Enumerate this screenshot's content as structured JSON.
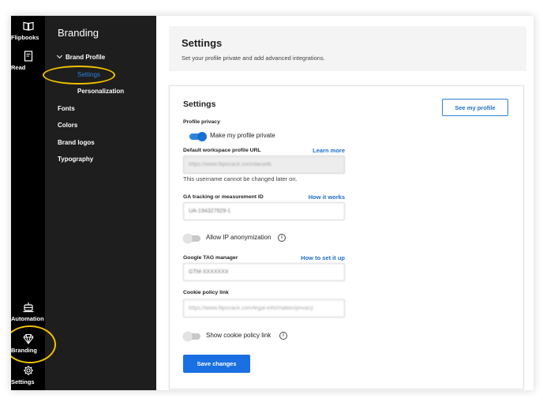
{
  "rail": {
    "items": [
      {
        "label": "Flipbooks",
        "icon": "book-icon"
      },
      {
        "label": "Read",
        "icon": "document-icon"
      },
      {
        "label": "Automation",
        "icon": "robot-icon"
      },
      {
        "label": "Branding",
        "icon": "diamond-icon"
      },
      {
        "label": "Settings",
        "icon": "gear-icon"
      }
    ]
  },
  "sidebar": {
    "title": "Branding",
    "group": "Brand Profile",
    "sub_items": [
      "Settings",
      "Personalization"
    ],
    "items": [
      "Fonts",
      "Colors",
      "Brand logos",
      "Typography"
    ]
  },
  "header": {
    "title": "Settings",
    "subtitle": "Set your profile private and add advanced integrations."
  },
  "card": {
    "title": "Settings",
    "see_profile_label": "See my profile",
    "privacy_label": "Profile privacy",
    "private_toggle_label": "Make my profile private",
    "private_toggle_on": true,
    "workspace_url_label": "Default workspace profile URL",
    "workspace_url_link": "Learn more",
    "workspace_url_value": "https://www.flipsnack.com/danielb",
    "workspace_url_help": "This username cannot be changed later on.",
    "ga_label": "GA tracking or measurement ID",
    "ga_link": "How it works",
    "ga_value": "UA-194327929-1",
    "ip_toggle_label": "Allow IP anonymization",
    "ip_toggle_on": false,
    "gtm_label": "Google TAG manager",
    "gtm_link": "How to set it up",
    "gtm_value": "GTM-XXXXXXX",
    "cookie_label": "Cookie policy link",
    "cookie_value": "https://www.flipsnack.com/legal-information/privacy",
    "cookie_toggle_label": "Show cookie policy link",
    "cookie_toggle_on": false,
    "save_label": "Save changes"
  },
  "colors": {
    "accent": "#1a6fe3",
    "highlight_ring": "#f2c200",
    "rail_bg": "#000000",
    "sidebar_bg": "#1e1e1e"
  }
}
